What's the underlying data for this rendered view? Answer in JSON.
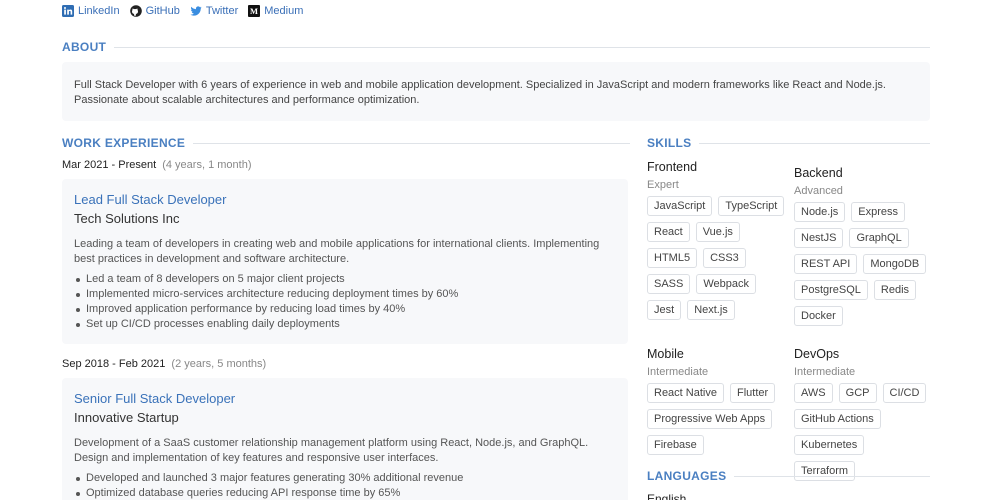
{
  "social": [
    {
      "label": "LinkedIn",
      "icon": "linkedin-icon"
    },
    {
      "label": "GitHub",
      "icon": "github-icon"
    },
    {
      "label": "Twitter",
      "icon": "twitter-icon"
    },
    {
      "label": "Medium",
      "icon": "medium-icon"
    }
  ],
  "about": {
    "title": "ABOUT",
    "text": "Full Stack Developer with 6 years of experience in web and mobile application development. Specialized in JavaScript and modern frameworks like React and Node.js. Passionate about scalable architectures and performance optimization."
  },
  "work": {
    "title": "WORK EXPERIENCE",
    "jobs": [
      {
        "period": "Mar 2021 - Present",
        "duration": "(4 years, 1 month)",
        "title": "Lead Full Stack Developer",
        "company": "Tech Solutions Inc",
        "description": "Leading a team of developers in creating web and mobile applications for international clients. Implementing best practices in development and software architecture.",
        "bullets": [
          "Led a team of 8 developers on 5 major client projects",
          "Implemented micro-services architecture reducing deployment times by 60%",
          "Improved application performance by reducing load times by 40%",
          "Set up CI/CD processes enabling daily deployments"
        ]
      },
      {
        "period": "Sep 2018 - Feb 2021",
        "duration": "(2 years, 5 months)",
        "title": "Senior Full Stack Developer",
        "company": "Innovative Startup",
        "description": "Development of a SaaS customer relationship management platform using React, Node.js, and GraphQL. Design and implementation of key features and responsive user interfaces.",
        "bullets": [
          "Developed and launched 3 major features generating 30% additional revenue",
          "Optimized database queries reducing API response time by 65%"
        ]
      }
    ]
  },
  "skills": {
    "title": "SKILLS",
    "groups": [
      {
        "name": "Frontend",
        "level": "Expert",
        "items": [
          "JavaScript",
          "TypeScript",
          "React",
          "Vue.js",
          "HTML5",
          "CSS3",
          "SASS",
          "Webpack",
          "Jest",
          "Next.js"
        ]
      },
      {
        "name": "Backend",
        "level": "Advanced",
        "items": [
          "Node.js",
          "Express",
          "NestJS",
          "GraphQL",
          "REST API",
          "MongoDB",
          "PostgreSQL",
          "Redis",
          "Docker"
        ]
      },
      {
        "name": "Mobile",
        "level": "Intermediate",
        "items": [
          "React Native",
          "Flutter",
          "Progressive Web Apps",
          "Firebase"
        ]
      },
      {
        "name": "DevOps",
        "level": "Intermediate",
        "items": [
          "AWS",
          "GCP",
          "CI/CD",
          "GitHub Actions",
          "Kubernetes",
          "Terraform"
        ]
      }
    ]
  },
  "languages": {
    "title": "LANGUAGES",
    "items": [
      "English"
    ]
  },
  "colors": {
    "accent": "#4a7fc1",
    "link": "#3a6fb7",
    "box": "#f7f8fa"
  }
}
